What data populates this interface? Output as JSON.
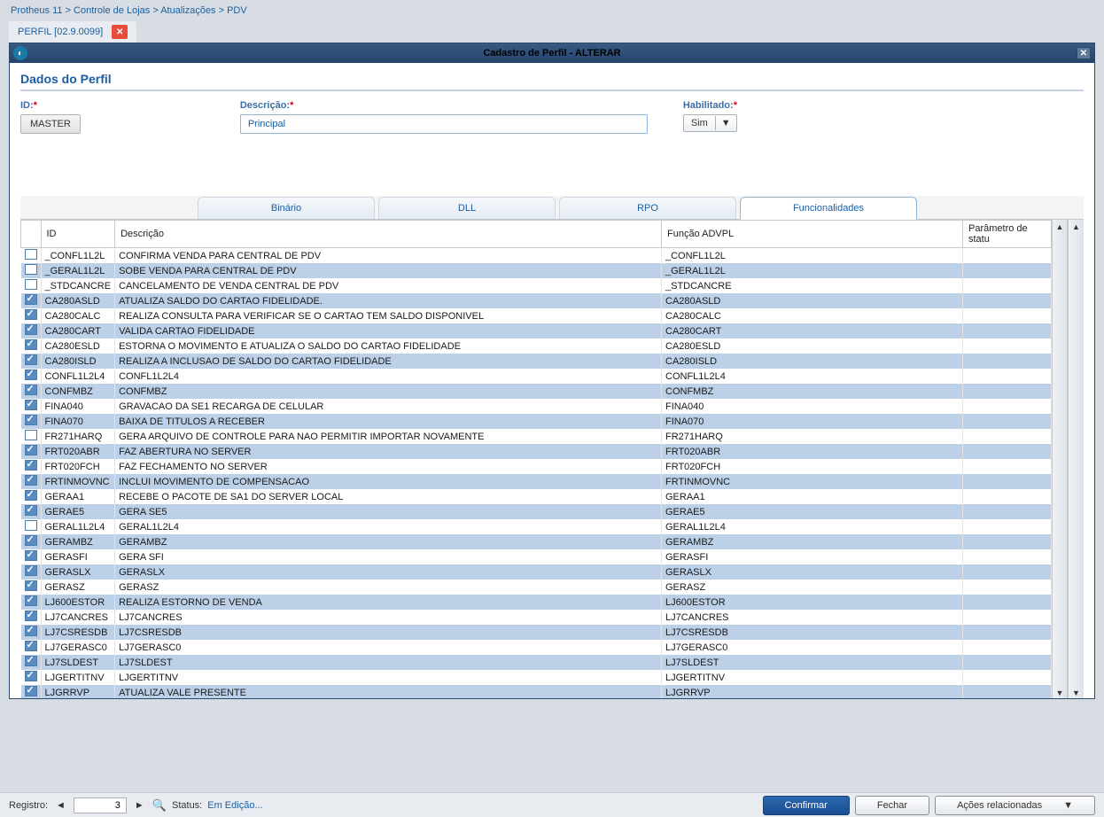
{
  "breadcrumb": "Protheus 11 > Controle de Lojas > Atualizações > PDV",
  "app_tab": "PERFIL [02.9.0099]",
  "window_title": "Cadastro de Perfil - ALTERAR",
  "section_title": "Dados do Perfil",
  "fields": {
    "id_label": "ID:",
    "id_value": "MASTER",
    "desc_label": "Descrição:",
    "desc_value": "Principal",
    "hab_label": "Habilitado:",
    "hab_value": "Sim"
  },
  "tabs": {
    "t0": "Binário",
    "t1": "DLL",
    "t2": "RPO",
    "t3": "Funcionalidades"
  },
  "columns": {
    "c0": "ID",
    "c1": "Descrição",
    "c2": "Função ADVPL",
    "c3": "Parâmetro de statu"
  },
  "rows": [
    {
      "chk": false,
      "id": "_CONFL1L2L",
      "desc": "CONFIRMA VENDA PARA CENTRAL DE PDV",
      "fn": "_CONFL1L2L"
    },
    {
      "chk": false,
      "id": "_GERAL1L2L",
      "desc": "SOBE VENDA PARA CENTRAL DE PDV",
      "fn": "_GERAL1L2L"
    },
    {
      "chk": false,
      "id": "_STDCANCRE",
      "desc": "CANCELAMENTO DE VENDA CENTRAL DE PDV",
      "fn": "_STDCANCRE"
    },
    {
      "chk": true,
      "id": "CA280ASLD",
      "desc": "ATUALIZA SALDO DO CARTAO FIDELIDADE.",
      "fn": "CA280ASLD"
    },
    {
      "chk": true,
      "id": "CA280CALC",
      "desc": "REALIZA CONSULTA PARA VERIFICAR SE O CARTAO TEM SALDO DISPONIVEL",
      "fn": "CA280CALC"
    },
    {
      "chk": true,
      "id": "CA280CART",
      "desc": "VALIDA CARTAO FIDELIDADE",
      "fn": "CA280CART"
    },
    {
      "chk": true,
      "id": "CA280ESLD",
      "desc": "ESTORNA O MOVIMENTO E ATUALIZA O SALDO DO CARTAO FIDELIDADE",
      "fn": "CA280ESLD"
    },
    {
      "chk": true,
      "id": "CA280ISLD",
      "desc": "REALIZA A INCLUSAO DE SALDO DO CARTAO FIDELIDADE",
      "fn": "CA280ISLD"
    },
    {
      "chk": true,
      "id": "CONFL1L2L4",
      "desc": "CONFL1L2L4",
      "fn": "CONFL1L2L4"
    },
    {
      "chk": true,
      "id": "CONFMBZ",
      "desc": "CONFMBZ",
      "fn": "CONFMBZ"
    },
    {
      "chk": true,
      "id": "FINA040",
      "desc": "GRAVACAO DA SE1 RECARGA DE CELULAR",
      "fn": "FINA040"
    },
    {
      "chk": true,
      "id": "FINA070",
      "desc": "BAIXA DE TITULOS A RECEBER",
      "fn": "FINA070"
    },
    {
      "chk": false,
      "id": "FR271HARQ",
      "desc": "GERA ARQUIVO DE CONTROLE PARA NAO PERMITIR IMPORTAR NOVAMENTE",
      "fn": "FR271HARQ"
    },
    {
      "chk": true,
      "id": "FRT020ABR",
      "desc": "FAZ ABERTURA NO SERVER",
      "fn": "FRT020ABR"
    },
    {
      "chk": true,
      "id": "FRT020FCH",
      "desc": "FAZ FECHAMENTO NO SERVER",
      "fn": "FRT020FCH"
    },
    {
      "chk": true,
      "id": "FRTINMOVNC",
      "desc": "INCLUI MOVIMENTO DE COMPENSACAO",
      "fn": "FRTINMOVNC"
    },
    {
      "chk": true,
      "id": "GERAA1",
      "desc": "RECEBE O PACOTE DE SA1 DO SERVER LOCAL",
      "fn": "GERAA1"
    },
    {
      "chk": true,
      "id": "GERAE5",
      "desc": "GERA SE5",
      "fn": "GERAE5"
    },
    {
      "chk": false,
      "id": "GERAL1L2L4",
      "desc": "GERAL1L2L4",
      "fn": "GERAL1L2L4"
    },
    {
      "chk": true,
      "id": "GERAMBZ",
      "desc": "GERAMBZ",
      "fn": "GERAMBZ"
    },
    {
      "chk": true,
      "id": "GERASFI",
      "desc": "GERA SFI",
      "fn": "GERASFI"
    },
    {
      "chk": true,
      "id": "GERASLX",
      "desc": "GERASLX",
      "fn": "GERASLX"
    },
    {
      "chk": true,
      "id": "GERASZ",
      "desc": "GERASZ",
      "fn": "GERASZ"
    },
    {
      "chk": true,
      "id": "LJ600ESTOR",
      "desc": "REALIZA ESTORNO DE VENDA",
      "fn": "LJ600ESTOR"
    },
    {
      "chk": true,
      "id": "LJ7CANCRES",
      "desc": "LJ7CANCRES",
      "fn": "LJ7CANCRES"
    },
    {
      "chk": true,
      "id": "LJ7CSRESDB",
      "desc": "LJ7CSRESDB",
      "fn": "LJ7CSRESDB"
    },
    {
      "chk": true,
      "id": "LJ7GERASC0",
      "desc": "LJ7GERASC0",
      "fn": "LJ7GERASC0"
    },
    {
      "chk": true,
      "id": "LJ7SLDEST",
      "desc": "LJ7SLDEST",
      "fn": "LJ7SLDEST"
    },
    {
      "chk": true,
      "id": "LJGERTITNV",
      "desc": "LJGERTITNV",
      "fn": "LJGERTITNV"
    },
    {
      "chk": true,
      "id": "LJGRRVP",
      "desc": "ATUALIZA VALE PRESENTE",
      "fn": "LJGRRVP"
    }
  ],
  "footer": {
    "registro_label": "Registro:",
    "registro_value": "3",
    "status_label": "Status:",
    "status_value": "Em Edição...",
    "btn_confirm": "Confirmar",
    "btn_close": "Fechar",
    "btn_actions": "Ações relacionadas"
  }
}
